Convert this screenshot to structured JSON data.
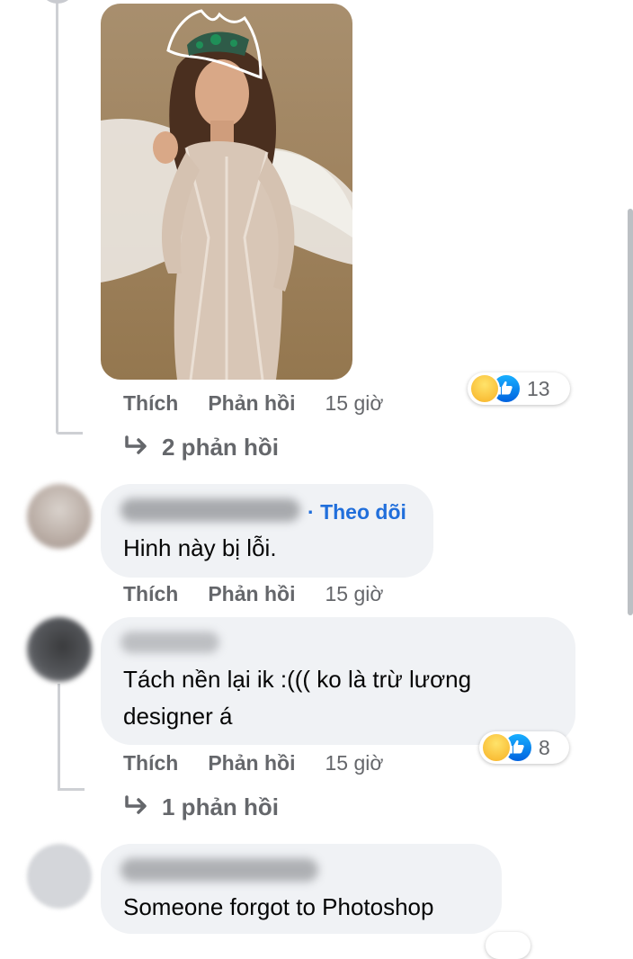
{
  "labels": {
    "like": "Thích",
    "reply": "Phản hồi"
  },
  "post_comment": {
    "time": "15 giờ",
    "reaction_count": "13",
    "reactions": [
      "haha-icon",
      "like-icon"
    ],
    "replies_link": "2 phản hồi"
  },
  "comments": [
    {
      "follow_label": "Theo dõi",
      "text": "Hinh này bị lỗi.",
      "time": "15 giờ"
    },
    {
      "text_line1": "Tách nền lại ik :((( ko là trừ lương",
      "text_line2": "designer á",
      "time": "15 giờ",
      "reaction_count": "8",
      "reactions": [
        "haha-icon",
        "like-icon"
      ],
      "replies_link": "1 phản hồi"
    },
    {
      "text": "Someone forgot to Photoshop"
    }
  ],
  "colors": {
    "bubble": "#f0f2f5",
    "secondary_text": "#65676b",
    "link_blue": "#216fdb",
    "like_blue": "#1877f2",
    "haha_yellow": "#f7b125"
  }
}
